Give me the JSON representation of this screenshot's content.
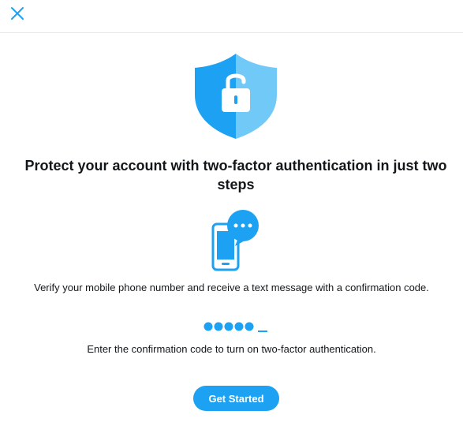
{
  "header": {
    "close_icon": "close-icon"
  },
  "hero": {
    "icon": "shield-lock-icon",
    "title": "Protect your account with two-factor authentication in just two steps"
  },
  "steps": [
    {
      "icon": "phone-message-icon",
      "text": "Verify your mobile phone number and receive a text message with a confirmation code."
    },
    {
      "icon": "confirmation-code-icon",
      "text": "Enter the confirmation code to turn on two-factor authentication."
    }
  ],
  "actions": {
    "primary_label": "Get Started"
  },
  "colors": {
    "accent": "#1da1f2",
    "accent_light": "#71c9f8",
    "text": "#14171a",
    "divider": "#e1e8ed"
  }
}
